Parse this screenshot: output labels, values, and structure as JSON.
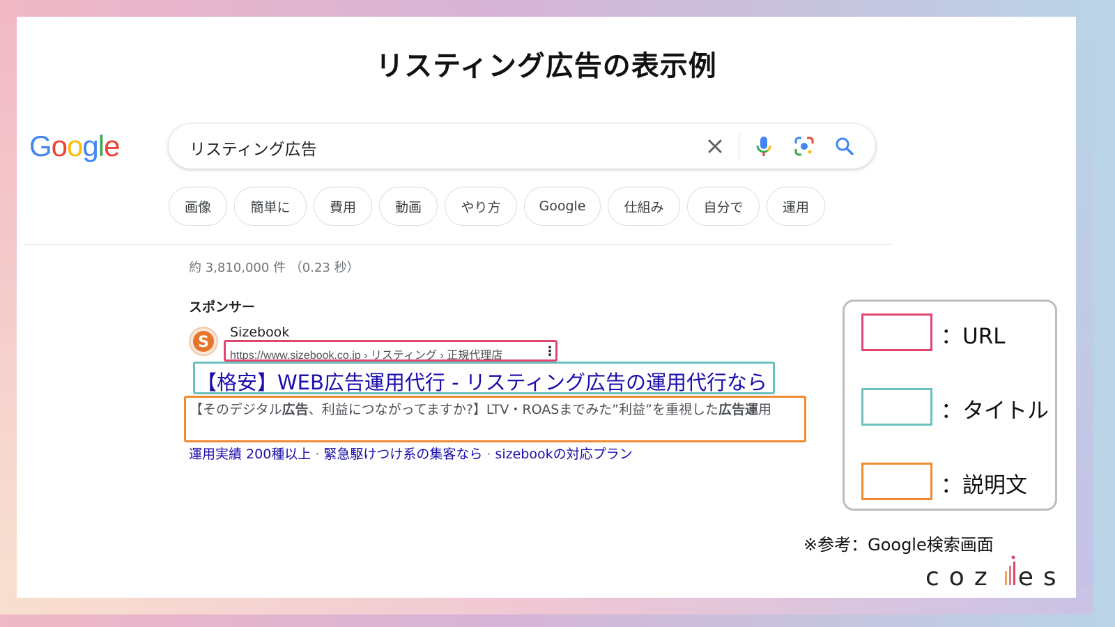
{
  "slide_title": "リスティング広告の表示例",
  "google_logo": {
    "letters": [
      "G",
      "o",
      "o",
      "g",
      "l",
      "e"
    ],
    "colors": [
      "#4285f4",
      "#ea4335",
      "#fbbc05",
      "#4285f4",
      "#34a853",
      "#ea4335"
    ]
  },
  "search": {
    "query": "リスティング広告",
    "icons": [
      "clear-icon",
      "microphone-icon",
      "lens-camera-icon",
      "search-icon"
    ]
  },
  "chips": [
    "画像",
    "簡単に",
    "費用",
    "動画",
    "やり方",
    "Google",
    "仕組み",
    "自分で",
    "運用"
  ],
  "results_stats": "約 3,810,000 件 （0.23 秒）",
  "sponsored_label": "スポンサー",
  "ad": {
    "favicon_letter": "S",
    "site_name": "Sizebook",
    "url": "https://www.sizebook.co.jp › リスティング › 正規代理店",
    "more_icon": "⋮",
    "title": "【格安】WEB広告運用代行 - リスティング広告の運用代行なら",
    "description_parts": [
      {
        "text": "【その",
        "bold": false
      },
      {
        "text": "デジタル",
        "bold": false
      },
      {
        "text": "広告",
        "bold": true
      },
      {
        "text": "、利益につながってますか?】LTV・ROASまでみた”利益”を重視した",
        "bold": false
      },
      {
        "text": "広告運",
        "bold": true
      },
      {
        "text": "用",
        "bold": false
      }
    ],
    "sitelinks": [
      "運用実績 200種以上",
      "緊急駆けつけ系の集客なら",
      "sizebookの対応プラン"
    ],
    "sitelink_separator": "·"
  },
  "legend": {
    "items": [
      {
        "label": "：URL",
        "color": "#e0456e"
      },
      {
        "label": "：タイトル",
        "color": "#6cc0bd"
      },
      {
        "label": "：説明文",
        "color": "#ef8a33"
      }
    ]
  },
  "reference_note": "※参考：Google検索画面",
  "brand": {
    "left": "coz",
    "right": "es"
  }
}
